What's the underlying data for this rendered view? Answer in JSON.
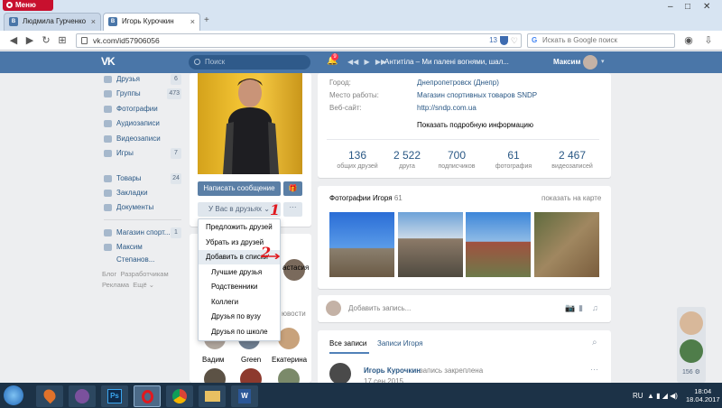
{
  "browser": {
    "menu_label": "Меню",
    "tabs": [
      {
        "label": "Людмила Гурченко"
      },
      {
        "label": "Игорь Курочкин"
      }
    ],
    "url": "vk.com/id57906056",
    "url_badge": "13",
    "search_placeholder": "Искать в Google поиск"
  },
  "vk": {
    "search_placeholder": "Поиск",
    "notif_count": "9",
    "track": "Антитіла – Ми палені вогнями, шал...",
    "user": "Максим"
  },
  "sidebar": {
    "items": [
      {
        "label": "Друзья",
        "count": "6"
      },
      {
        "label": "Группы",
        "count": "473"
      },
      {
        "label": "Фотографии",
        "count": ""
      },
      {
        "label": "Аудиозаписи",
        "count": ""
      },
      {
        "label": "Видеозаписи",
        "count": ""
      },
      {
        "label": "Игры",
        "count": "7"
      },
      {
        "label": "Товары",
        "count": "24"
      },
      {
        "label": "Закладки",
        "count": ""
      },
      {
        "label": "Документы",
        "count": ""
      },
      {
        "label": "Магазин спорт...",
        "count": "1"
      },
      {
        "label": "Максим Степанов...",
        "count": ""
      }
    ],
    "footer": [
      "Блог",
      "Разработчикам",
      "Реклама",
      "Ещё ⌄"
    ]
  },
  "profile": {
    "send_message": "Написать сообщение",
    "in_friends": "У Вас в друзьях ⌄",
    "dropdown": [
      "Предложить друзей",
      "Убрать из друзей",
      "Добавить в списки",
      "Лучшие друзья",
      "Родственники",
      "Коллеги",
      "Друзья по вузу",
      "Друзья по школе"
    ],
    "annotation_1": "1",
    "annotation_2": "2",
    "partial_labels": [
      "астасия",
      "ювости"
    ],
    "friends": [
      "Вадим",
      "Green",
      "Екатерина"
    ]
  },
  "info": {
    "rows": [
      {
        "label": "Город:",
        "value": "Днепропетровск (Днепр)"
      },
      {
        "label": "Место работы:",
        "value": "Магазин спортивных товаров SNDP"
      },
      {
        "label": "Веб-сайт:",
        "value": "http://sndp.com.ua"
      }
    ],
    "more": "Показать подробную информацию",
    "stats": [
      {
        "n": "136",
        "l": "общих друзей"
      },
      {
        "n": "2 522",
        "l": "друга"
      },
      {
        "n": "700",
        "l": "подписчиков"
      },
      {
        "n": "61",
        "l": "фотография"
      },
      {
        "n": "2 467",
        "l": "видеозаписей"
      }
    ]
  },
  "photos": {
    "title": "Фотографии Игоря",
    "count": "61",
    "map": "показать на карте"
  },
  "post_placeholder": "Добавить запись...",
  "wall": {
    "tab_all": "Все записи",
    "tab_own": "Записи Игоря",
    "author": "Игорь Курочкин",
    "pinned": "запись закреплена",
    "date": "17 сен 2015"
  },
  "right_count": "156",
  "taskbar": {
    "lang": "RU",
    "time": "18:04",
    "date": "18.04.2017"
  }
}
